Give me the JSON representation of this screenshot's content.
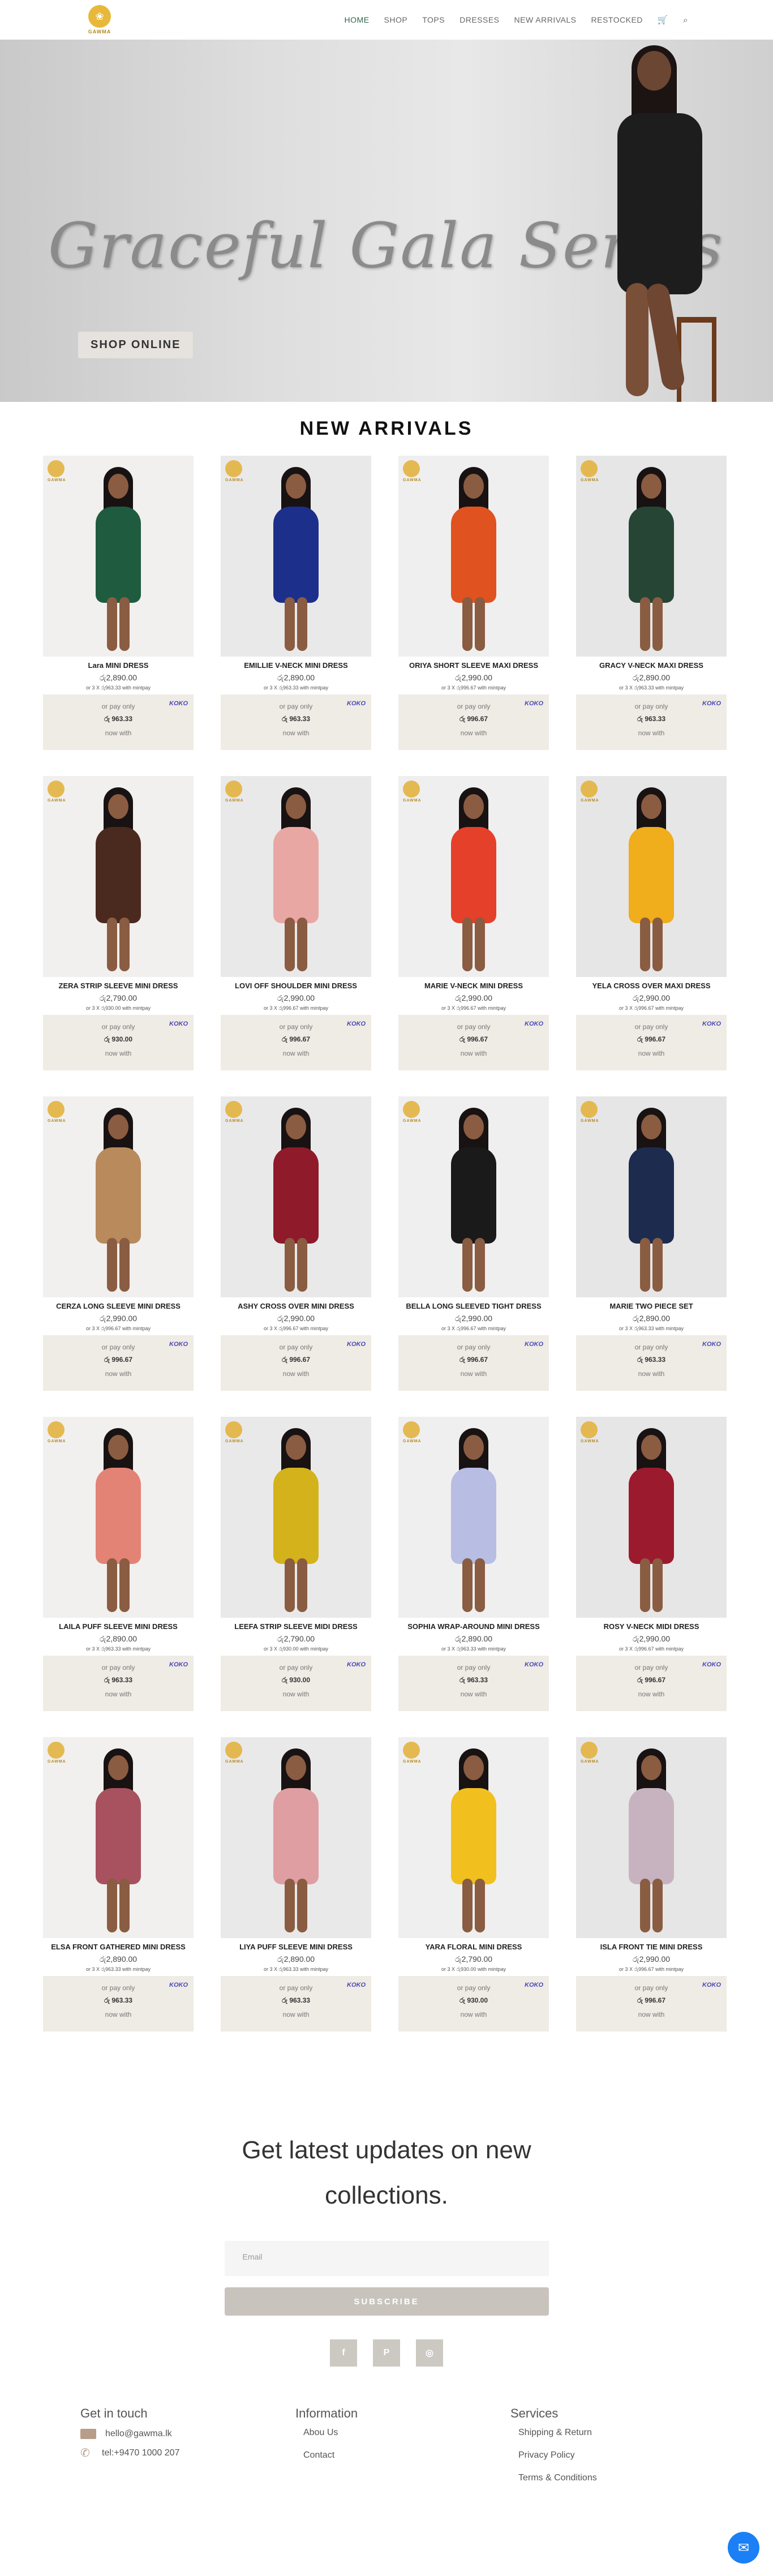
{
  "header": {
    "logo_text": "GAWMA",
    "nav": [
      {
        "label": "HOME"
      },
      {
        "label": "SHOP"
      },
      {
        "label": "TOPS"
      },
      {
        "label": "DRESSES"
      },
      {
        "label": "NEW ARRIVALS"
      },
      {
        "label": "RESTOCKED"
      }
    ],
    "cart_icon": "cart-icon",
    "search_icon": "search-icon",
    "active_color": "#2b6a45"
  },
  "hero": {
    "title": "Graceful Gala Series",
    "button_label": "SHOP ONLINE"
  },
  "new_arrivals": {
    "title": "NEW ARRIVALS",
    "or_pay_label": "or pay only",
    "now_with_label": "now with",
    "koko_label": "KOKO",
    "products": [
      {
        "name": "Lara MINI DRESS",
        "price": "රු2,890.00",
        "installment": "or 3 X රු963.33 with mintpay",
        "koko_amount": "රු 963.33",
        "dress_color": "#1f5b3f"
      },
      {
        "name": "EMILLIE V-NECK MINI DRESS",
        "price": "රු2,890.00",
        "installment": "or 3 X රු963.33 with mintpay",
        "koko_amount": "රු 963.33",
        "dress_color": "#1c2f8a"
      },
      {
        "name": "ORIYA SHORT SLEEVE MAXI DRESS",
        "price": "රු2,990.00",
        "installment": "or 3 X රු996.67 with mintpay",
        "koko_amount": "රු 996.67",
        "dress_color": "#e0521f"
      },
      {
        "name": "GRACY V-NECK MAXI DRESS",
        "price": "රු2,890.00",
        "installment": "or 3 X රු963.33 with mintpay",
        "koko_amount": "රු 963.33",
        "dress_color": "#264535"
      },
      {
        "name": "ZERA STRIP SLEEVE MINI DRESS",
        "price": "රු2,790.00",
        "installment": "or 3 X රු930.00 with mintpay",
        "koko_amount": "රු 930.00",
        "dress_color": "#4a2a1f"
      },
      {
        "name": "LOVI OFF SHOULDER MINI DRESS",
        "price": "රු2,990.00",
        "installment": "or 3 X රු996.67 with mintpay",
        "koko_amount": "රු 996.67",
        "dress_color": "#e9a7a4"
      },
      {
        "name": "MARIE V-NECK MINI DRESS",
        "price": "රු2,990.00",
        "installment": "or 3 X රු996.67 with mintpay",
        "koko_amount": "රු 996.67",
        "dress_color": "#e4402a"
      },
      {
        "name": "YELA CROSS OVER MAXI DRESS",
        "price": "රු2,990.00",
        "installment": "or 3 X රු996.67 with mintpay",
        "koko_amount": "රු 996.67",
        "dress_color": "#f0ad1c"
      },
      {
        "name": "CERZA LONG SLEEVE MINI DRESS",
        "price": "රු2,990.00",
        "installment": "or 3 X රු996.67 with mintpay",
        "koko_amount": "රු 996.67",
        "dress_color": "#b88a5c"
      },
      {
        "name": "ASHY CROSS OVER MINI DRESS",
        "price": "රු2,990.00",
        "installment": "or 3 X රු996.67 with mintpay",
        "koko_amount": "රු 996.67",
        "dress_color": "#8e1a2a"
      },
      {
        "name": "BELLA LONG SLEEVED TIGHT DRESS",
        "price": "රු2,990.00",
        "installment": "or 3 X රු996.67 with mintpay",
        "koko_amount": "රු 996.67",
        "dress_color": "#1a1a1a"
      },
      {
        "name": "MARIE TWO PIECE SET",
        "price": "රු2,890.00",
        "installment": "or 3 X රු963.33 with mintpay",
        "koko_amount": "රු 963.33",
        "dress_color": "#1d2b4f"
      },
      {
        "name": "LAILA PUFF SLEEVE MINI DRESS",
        "price": "රු2,890.00",
        "installment": "or 3 X රු963.33 with mintpay",
        "koko_amount": "රු 963.33",
        "dress_color": "#e38375"
      },
      {
        "name": "LEEFA STRIP SLEEVE MIDI DRESS",
        "price": "රු2,790.00",
        "installment": "or 3 X රු930.00 with mintpay",
        "koko_amount": "රු 930.00",
        "dress_color": "#d4b21c"
      },
      {
        "name": "SOPHIA WRAP-AROUND MINI DRESS",
        "price": "රු2,890.00",
        "installment": "or 3 X රු963.33 with mintpay",
        "koko_amount": "රු 963.33",
        "dress_color": "#b7bde3"
      },
      {
        "name": "ROSY V-NECK MIDI DRESS",
        "price": "රු2,990.00",
        "installment": "or 3 X රු996.67 with mintpay",
        "koko_amount": "රු 996.67",
        "dress_color": "#9c1a2e"
      },
      {
        "name": "ELSA FRONT GATHERED MINI DRESS",
        "price": "රු2,890.00",
        "installment": "or 3 X රු963.33 with mintpay",
        "koko_amount": "රු 963.33",
        "dress_color": "#a8525f"
      },
      {
        "name": "LIYA PUFF SLEEVE MINI DRESS",
        "price": "රු2,890.00",
        "installment": "or 3 X රු963.33 with mintpay",
        "koko_amount": "රු 963.33",
        "dress_color": "#df9ea1"
      },
      {
        "name": "YARA FLORAL MINI DRESS",
        "price": "රු2,790.00",
        "installment": "or 3 X රු930.00 with mintpay",
        "koko_amount": "රු 930.00",
        "dress_color": "#f2c01e"
      },
      {
        "name": "ISLA FRONT TIE MINI DRESS",
        "price": "රු2,990.00",
        "installment": "or 3 X රු996.67 with mintpay",
        "koko_amount": "රු 996.67",
        "dress_color": "#c7b3bf"
      }
    ]
  },
  "newsletter": {
    "title_line1": "Get latest updates on new",
    "title_line2": "collections.",
    "email_placeholder": "Email",
    "subscribe_label": "SUBSCRIBE",
    "socials": [
      {
        "icon": "facebook-icon",
        "glyph": "f"
      },
      {
        "icon": "pinterest-icon",
        "glyph": "P"
      },
      {
        "icon": "instagram-icon",
        "glyph": "◎"
      }
    ]
  },
  "footer": {
    "contact_title": "Get in touch",
    "email": "hello@gawma.lk",
    "phone": "tel:+9470 1000 207",
    "info_title": "Information",
    "info_links": [
      "Abou Us",
      "Contact"
    ],
    "services_title": "Services",
    "services_links": [
      "Shipping & Return",
      "Privacy Policy",
      "Terms & Conditions"
    ]
  }
}
